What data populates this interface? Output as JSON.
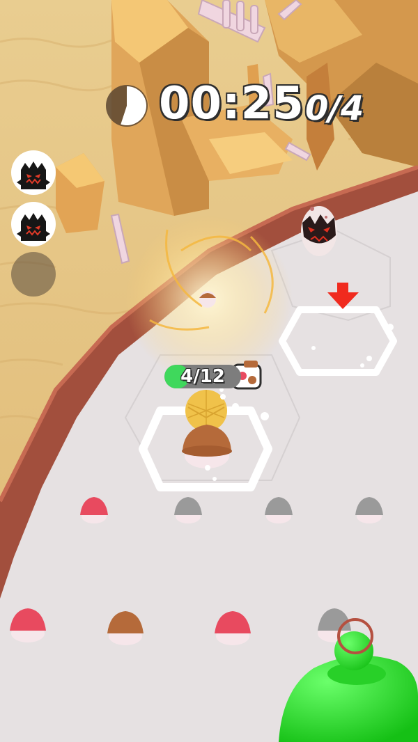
{
  "hud": {
    "timer": "00:25",
    "timer_elapsed_fraction": 0.55,
    "eggs_collected": "0/4"
  },
  "boss_queue": [
    {
      "state": "filled",
      "icon": "dark-egg-monster-icon"
    },
    {
      "state": "filled",
      "icon": "dark-egg-monster-icon"
    },
    {
      "state": "empty",
      "icon": "empty-slot-icon"
    }
  ],
  "player": {
    "carry_count": "4/12",
    "carry_fraction": 0.33
  },
  "colors": {
    "sand": "#e8c887",
    "arena": "#e6e1e2",
    "arena_rim": "#a24f3d",
    "red_mushroom": "#e84a5f",
    "brown_mushroom": "#b56a3a",
    "gray_mushroom": "#9a9a9a",
    "green_player": "#2ee02e",
    "hud_text": "#ffffff",
    "carry_bar": "#3fd85c"
  }
}
